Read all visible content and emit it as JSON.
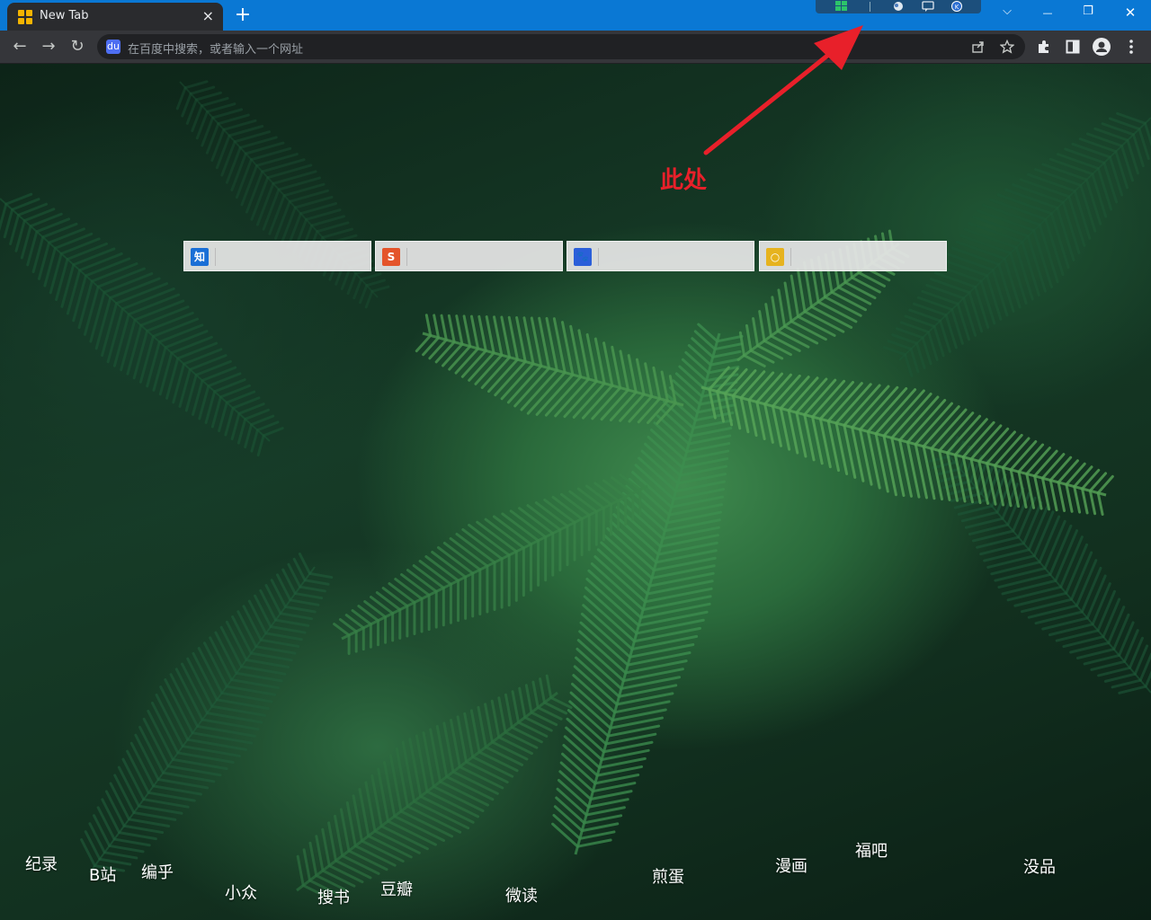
{
  "tab": {
    "title": "New Tab",
    "close_icon": "×"
  },
  "new_tab_icon": "+",
  "window_controls": {
    "dropdown": "⌵",
    "minimize": "—",
    "restore": "❐",
    "close": "✕"
  },
  "nav": {
    "back": "←",
    "forward": "→",
    "reload": "↻"
  },
  "omnibox": {
    "placeholder": "在百度中搜索，或者输入一个网址",
    "engine_icon": "du"
  },
  "toolbar_icons": [
    "share-icon",
    "star-icon",
    "extensions-icon",
    "side-panel-icon",
    "profile-icon",
    "menu-icon"
  ],
  "search_engines": [
    {
      "name": "zhihu",
      "glyph": "知",
      "color": "#1a6fd6"
    },
    {
      "name": "sogou",
      "glyph": "S",
      "color": "#e4542a"
    },
    {
      "name": "baidu",
      "glyph": "🐾",
      "color": "#2b5fd9"
    },
    {
      "name": "360",
      "glyph": "○",
      "color": "#e6b31e"
    }
  ],
  "annotation": {
    "text": "此处",
    "color": "#e8202a"
  },
  "site_links": [
    {
      "label": "纪录"
    },
    {
      "label": "B站"
    },
    {
      "label": "编乎"
    },
    {
      "label": "小众"
    },
    {
      "label": "搜书"
    },
    {
      "label": "豆瓣"
    },
    {
      "label": "微读"
    },
    {
      "label": "煎蛋"
    },
    {
      "label": "漫画"
    },
    {
      "label": "福吧"
    },
    {
      "label": "没品"
    }
  ]
}
